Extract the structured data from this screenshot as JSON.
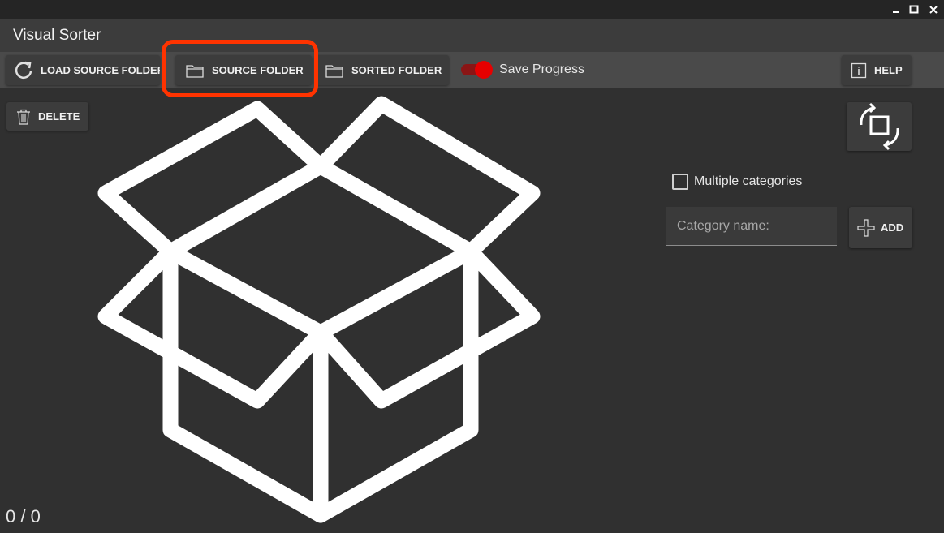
{
  "window": {
    "minimize_glyph": "▁",
    "maximize_glyph": "□",
    "close_glyph": "✕"
  },
  "app": {
    "title": "Visual Sorter"
  },
  "toolbar": {
    "load_source_label": "LOAD SOURCE FOLDER",
    "source_folder_label": "SOURCE FOLDER",
    "sorted_folder_label": "SORTED FOLDER",
    "save_progress_label": "Save Progress",
    "save_progress_on": true,
    "help_label": "HELP"
  },
  "actions": {
    "delete_label": "DELETE"
  },
  "categories": {
    "multiple_label": "Multiple categories",
    "multiple_checked": false,
    "input_placeholder": "Category name:",
    "input_value": "",
    "add_label": "ADD"
  },
  "counter": "0 / 0",
  "colors": {
    "background": "#303030",
    "toolbar": "#4a4a4a",
    "button": "#3c3c3c",
    "accent": "#e60000",
    "highlight": "#ff3300"
  },
  "icons": {
    "load": "refresh-icon",
    "folder": "folder-icon",
    "help": "info-icon",
    "delete": "trash-icon",
    "rotate": "rotate-icon",
    "add": "plus-icon",
    "empty": "open-box-icon"
  }
}
